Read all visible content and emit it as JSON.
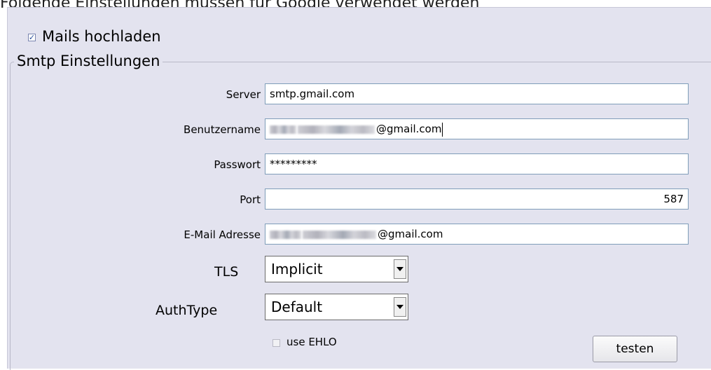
{
  "caption": "Folgende Einstellungen müssen für Google verwendet werden",
  "mails_upload": {
    "label": "Mails hochladen",
    "checked": true
  },
  "smtp": {
    "legend": "Smtp Einstellungen",
    "fields": {
      "server": {
        "label": "Server",
        "value": "smtp.gmail.com"
      },
      "username": {
        "label": "Benutzername",
        "value_suffix": "@gmail.com"
      },
      "password": {
        "label": "Passwort",
        "value": "*********"
      },
      "port": {
        "label": "Port",
        "value": "587"
      },
      "email": {
        "label": "E-Mail Adresse",
        "value_suffix": "@gmail.com"
      }
    },
    "tls": {
      "label": "TLS",
      "selected": "Implicit"
    },
    "authtype": {
      "label": "AuthType",
      "selected": "Default"
    },
    "use_ehlo": {
      "label": "use EHLO",
      "checked": false,
      "enabled": false
    },
    "test_button": "testen"
  }
}
